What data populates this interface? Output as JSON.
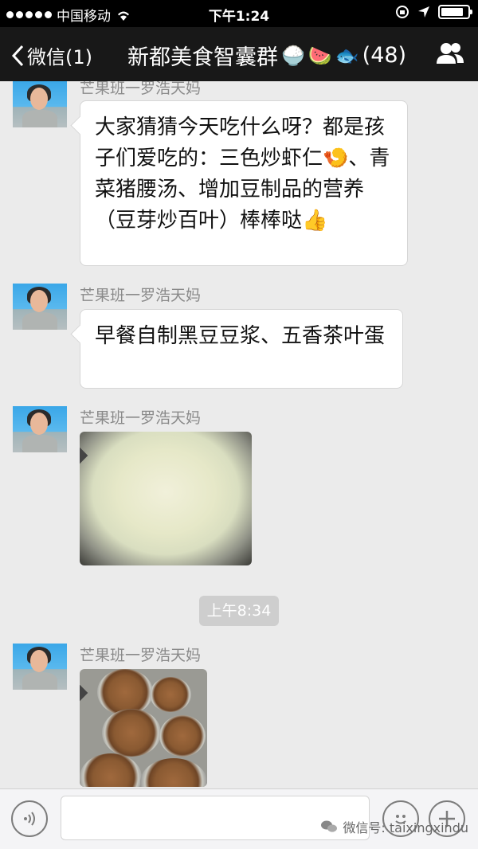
{
  "status_bar": {
    "carrier": "中国移动",
    "time": "下午1:24",
    "battery_level": 0.85
  },
  "nav": {
    "back_label": "微信(1)",
    "title": "新都美食智囊群",
    "title_emojis": [
      "🍚",
      "🍉",
      "🐟"
    ],
    "member_count": "(48)",
    "group_icon": "group-members-icon"
  },
  "messages": [
    {
      "sender": "芒果班一罗浩天妈",
      "type": "text",
      "text": "大家猜猜今天吃什么呀？都是孩子们爱吃的：三色炒虾仁🍤、青菜猪腰汤、增加豆制品的营养（豆芽炒百叶）棒棒哒👍"
    },
    {
      "sender": "芒果班一罗浩天妈",
      "type": "text",
      "text": "早餐自制黑豆豆浆、五香茶叶蛋"
    },
    {
      "sender": "芒果班一罗浩天妈",
      "type": "image",
      "image": "soy-milk-pot-photo"
    },
    {
      "sender": "芒果班一罗浩天妈",
      "type": "image",
      "image": "tea-eggs-bowls-photo"
    }
  ],
  "timestamp": "上午8:34",
  "input_bar": {
    "voice_icon": "voice-icon",
    "emoji_icon": "emoji-face-icon",
    "plus_icon": "plus-icon",
    "input_value": ""
  },
  "watermark": {
    "text": "微信号: taixingxindu"
  },
  "colors": {
    "nav_bg": "#181818",
    "chat_bg": "#ebebeb",
    "bubble_bg": "#ffffff",
    "sender_text": "#8a8a8a"
  }
}
